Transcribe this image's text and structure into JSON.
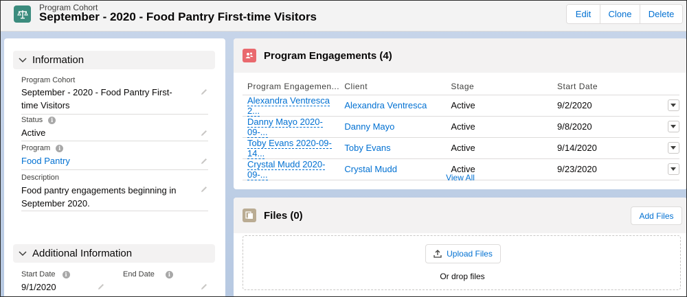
{
  "header": {
    "object_type": "Program Cohort",
    "title": "September - 2020 - Food Pantry First-time Visitors",
    "buttons": {
      "edit": "Edit",
      "clone": "Clone",
      "delete": "Delete"
    }
  },
  "information": {
    "section_label": "Information",
    "fields": {
      "program_cohort": {
        "label": "Program Cohort",
        "value": "September - 2020 - Food Pantry First-time Visitors"
      },
      "status": {
        "label": "Status",
        "value": "Active"
      },
      "program": {
        "label": "Program",
        "value": "Food Pantry"
      },
      "description": {
        "label": "Description",
        "value": "Food pantry engagements beginning in September 2020."
      }
    }
  },
  "additional": {
    "section_label": "Additional Information",
    "start_date": {
      "label": "Start Date",
      "value": "9/1/2020"
    },
    "end_date": {
      "label": "End Date",
      "value": ""
    }
  },
  "engagements": {
    "title": "Program Engagements (4)",
    "columns": [
      "Program Engagemen...",
      "Client",
      "Stage",
      "Start Date"
    ],
    "rows": [
      {
        "name": "Alexandra Ventresca 2...",
        "client": "Alexandra Ventresca",
        "stage": "Active",
        "start": "9/2/2020"
      },
      {
        "name": "Danny Mayo 2020-09-...",
        "client": "Danny Mayo",
        "stage": "Active",
        "start": "9/8/2020"
      },
      {
        "name": "Toby Evans 2020-09-14...",
        "client": "Toby Evans",
        "stage": "Active",
        "start": "9/14/2020"
      },
      {
        "name": "Crystal Mudd 2020-09-...",
        "client": "Crystal Mudd",
        "stage": "Active",
        "start": "9/23/2020"
      }
    ],
    "view_all": "View All"
  },
  "files": {
    "title": "Files (0)",
    "add_files": "Add Files",
    "upload_files": "Upload Files",
    "drop_text": "Or drop files"
  },
  "colors": {
    "brand": "#0070d2",
    "header_icon": "#3b8c7e",
    "engagement_icon": "#e9696e",
    "files_icon": "#baac93"
  }
}
